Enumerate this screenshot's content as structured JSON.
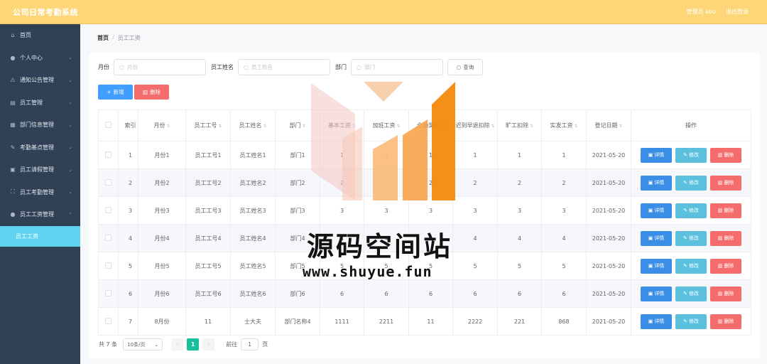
{
  "app": {
    "title": "公司日常考勤系统",
    "admin_label": "管理员 abo",
    "logout_label": "退出登录"
  },
  "sidebar": {
    "items": [
      {
        "label": "首页",
        "icon": "home-icon",
        "glyph": "⌂"
      },
      {
        "label": "个人中心",
        "icon": "user-icon",
        "glyph": "●"
      },
      {
        "label": "通知公告管理",
        "icon": "notice-icon",
        "glyph": "⚠"
      },
      {
        "label": "员工管理",
        "icon": "staff-icon",
        "glyph": "▤"
      },
      {
        "label": "部门信息管理",
        "icon": "department-icon",
        "glyph": "▦"
      },
      {
        "label": "考勤基点管理",
        "icon": "attendance-point-icon",
        "glyph": "✎"
      },
      {
        "label": "员工请假管理",
        "icon": "leave-icon",
        "glyph": "▣"
      },
      {
        "label": "员工考勤管理",
        "icon": "attendance-icon",
        "glyph": "⛶"
      },
      {
        "label": "员工工资管理",
        "icon": "salary-icon",
        "glyph": "●"
      }
    ],
    "active_sub": "员工工资"
  },
  "breadcrumb": {
    "home": "首页",
    "sep": "/",
    "current": "员工工资"
  },
  "filters": {
    "month_label": "月份",
    "month_placeholder": "月份",
    "name_label": "员工姓名",
    "name_placeholder": "员工姓名",
    "dept_label": "部门",
    "dept_placeholder": "部门",
    "query_label": "查询"
  },
  "actions": {
    "add_label": "新增",
    "delete_label": "删除"
  },
  "table": {
    "headers": [
      "索引",
      "月份",
      "员工工号",
      "员工姓名",
      "部门",
      "基本工资",
      "加班工资",
      "全勤奖励",
      "迟到早退扣除",
      "旷工扣除",
      "实发工资",
      "登记日期",
      "操作"
    ],
    "rows": [
      [
        "1",
        "月份1",
        "员工工号1",
        "员工姓名1",
        "部门1",
        "1",
        "1",
        "1",
        "1",
        "1",
        "1",
        "2021-05-20"
      ],
      [
        "2",
        "月份2",
        "员工工号2",
        "员工姓名2",
        "部门2",
        "2",
        "2",
        "2",
        "2",
        "2",
        "2",
        "2021-05-20"
      ],
      [
        "3",
        "月份3",
        "员工工号3",
        "员工姓名3",
        "部门3",
        "3",
        "3",
        "3",
        "3",
        "3",
        "3",
        "2021-05-20"
      ],
      [
        "4",
        "月份4",
        "员工工号4",
        "员工姓名4",
        "部门4",
        "4",
        "4",
        "4",
        "4",
        "4",
        "4",
        "2021-05-20"
      ],
      [
        "5",
        "月份5",
        "员工工号5",
        "员工姓名5",
        "部门5",
        "5",
        "5",
        "5",
        "5",
        "5",
        "5",
        "2021-05-20"
      ],
      [
        "6",
        "月份6",
        "员工工号6",
        "员工姓名6",
        "部门6",
        "6",
        "6",
        "6",
        "6",
        "6",
        "6",
        "2021-05-20"
      ],
      [
        "7",
        "8月份",
        "11",
        "士大夫",
        "部门名称4",
        "1111",
        "2211",
        "11",
        "2222",
        "221",
        "868",
        "2021-05-20"
      ]
    ],
    "row_actions": {
      "detail": "详情",
      "edit": "修改",
      "remove": "删除"
    }
  },
  "pagination": {
    "total": "共 7 条",
    "page_size": "10条/页",
    "current_page": "1",
    "goto_label": "前往",
    "goto_value": "1",
    "page_suffix": "页"
  },
  "watermark": {
    "text": "源码空间站",
    "url": "www.shuyue.fun"
  },
  "colors": {
    "topbar": "#fdd678",
    "sidebar": "#304156",
    "active_sub": "#5fd2ef",
    "primary": "#409eff",
    "danger": "#f56c6c",
    "page_active": "#19be9b",
    "logo_orange": "#f6890c"
  }
}
